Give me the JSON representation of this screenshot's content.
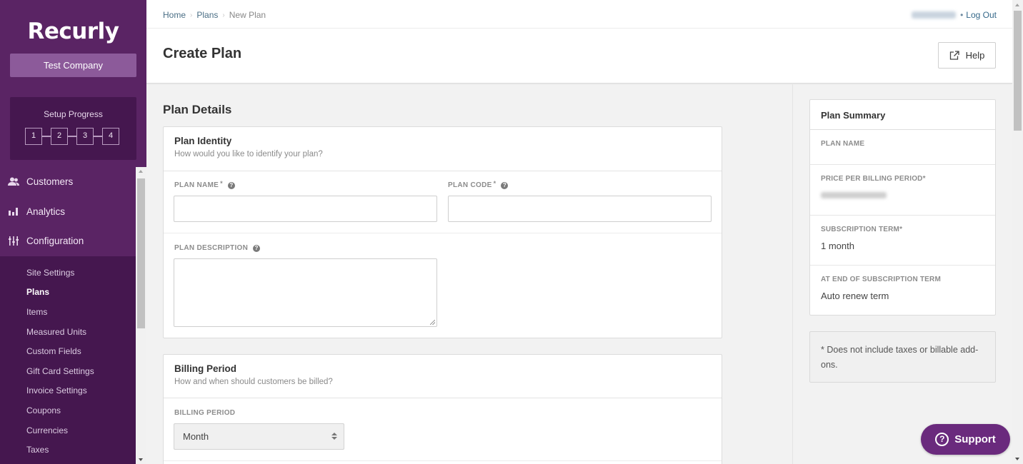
{
  "brand": {
    "logo_text": "Recurly",
    "company": "Test Company",
    "primary_color": "#5a2464",
    "accent_color": "#6a2a7d"
  },
  "setup_progress": {
    "title": "Setup Progress",
    "steps": [
      "1",
      "2",
      "3",
      "4"
    ]
  },
  "nav": {
    "main": [
      {
        "label": "Customers",
        "icon": "customers-icon"
      },
      {
        "label": "Analytics",
        "icon": "bar-chart-icon"
      },
      {
        "label": "Configuration",
        "icon": "sliders-icon"
      }
    ],
    "sub": [
      {
        "label": "Site Settings",
        "active": false
      },
      {
        "label": "Plans",
        "active": true
      },
      {
        "label": "Items",
        "active": false
      },
      {
        "label": "Measured Units",
        "active": false
      },
      {
        "label": "Custom Fields",
        "active": false
      },
      {
        "label": "Gift Card Settings",
        "active": false
      },
      {
        "label": "Invoice Settings",
        "active": false
      },
      {
        "label": "Coupons",
        "active": false
      },
      {
        "label": "Currencies",
        "active": false
      },
      {
        "label": "Taxes",
        "active": false
      }
    ]
  },
  "breadcrumb": {
    "items": [
      "Home",
      "Plans",
      "New Plan"
    ]
  },
  "user": {
    "separator": "•",
    "logout_label": "Log Out"
  },
  "header": {
    "title": "Create Plan",
    "help_label": "Help"
  },
  "main": {
    "section_title": "Plan Details",
    "plan_identity": {
      "title": "Plan Identity",
      "subtitle": "How would you like to identify your plan?",
      "plan_name_label": "PLAN NAME",
      "plan_name_value": "",
      "plan_code_label": "PLAN CODE",
      "plan_code_value": "",
      "required_mark": "*",
      "description_label": "PLAN DESCRIPTION",
      "description_value": ""
    },
    "billing_period": {
      "title": "Billing Period",
      "subtitle": "How and when should customers be billed?",
      "label": "BILLING PERIOD",
      "selected": "Month"
    }
  },
  "summary": {
    "title": "Plan Summary",
    "rows": [
      {
        "label": "PLAN NAME",
        "value": ""
      },
      {
        "label": "PRICE PER BILLING PERIOD*",
        "value": ""
      },
      {
        "label": "SUBSCRIPTION TERM*",
        "value": "1 month"
      },
      {
        "label": "AT END OF SUBSCRIPTION TERM",
        "value": "Auto renew term"
      }
    ],
    "note": "* Does not include taxes or billable add-ons."
  },
  "support": {
    "label": "Support",
    "icon_glyph": "?"
  },
  "help_glyph": "?"
}
